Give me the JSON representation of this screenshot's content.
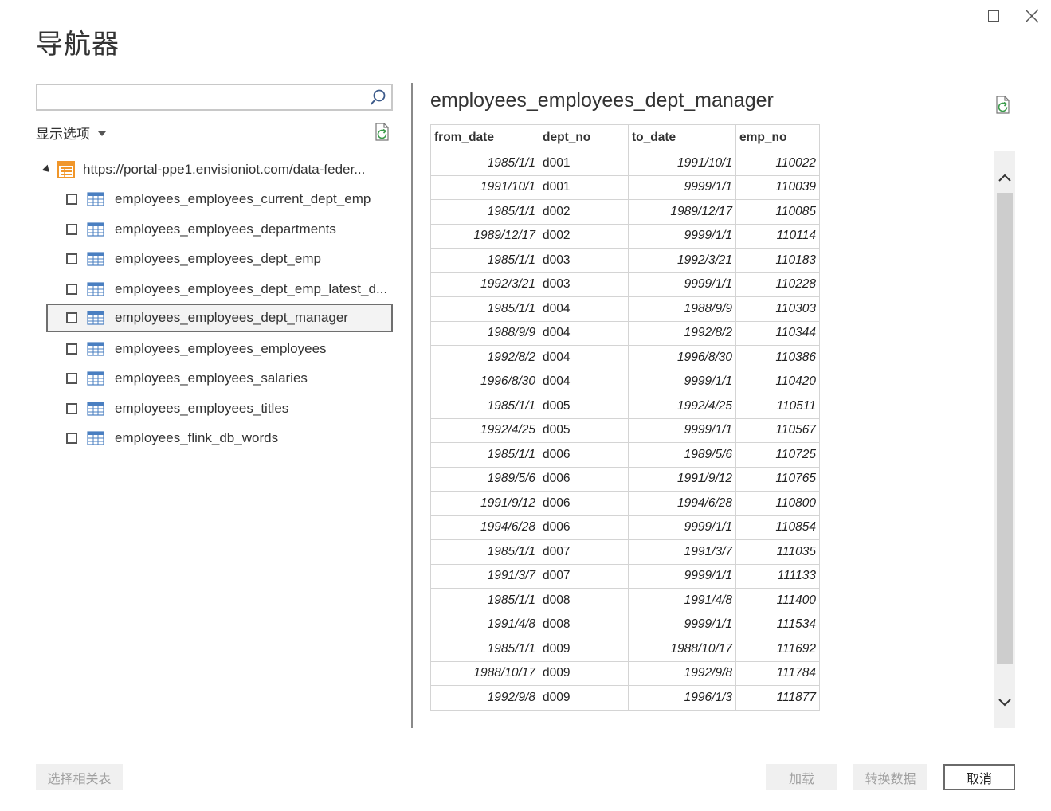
{
  "window": {
    "title": "导航器"
  },
  "search": {
    "value": "",
    "placeholder": ""
  },
  "left": {
    "display_options_label": "显示选项",
    "root_label": "https://portal-ppe1.envisioniot.com/data-feder...",
    "items": [
      {
        "label": "employees_employees_current_dept_emp",
        "checked": false
      },
      {
        "label": "employees_employees_departments",
        "checked": false
      },
      {
        "label": "employees_employees_dept_emp",
        "checked": false
      },
      {
        "label": "employees_employees_dept_emp_latest_d...",
        "checked": false
      },
      {
        "label": "employees_employees_dept_manager",
        "checked": false,
        "selected": true
      },
      {
        "label": "employees_employees_employees",
        "checked": false
      },
      {
        "label": "employees_employees_salaries",
        "checked": false
      },
      {
        "label": "employees_employees_titles",
        "checked": false
      },
      {
        "label": "employees_flink_db_words",
        "checked": false
      }
    ]
  },
  "preview": {
    "title": "employees_employees_dept_manager",
    "columns": [
      "from_date",
      "dept_no",
      "to_date",
      "emp_no"
    ],
    "rows": [
      [
        "1985/1/1",
        "d001",
        "1991/10/1",
        "110022"
      ],
      [
        "1991/10/1",
        "d001",
        "9999/1/1",
        "110039"
      ],
      [
        "1985/1/1",
        "d002",
        "1989/12/17",
        "110085"
      ],
      [
        "1989/12/17",
        "d002",
        "9999/1/1",
        "110114"
      ],
      [
        "1985/1/1",
        "d003",
        "1992/3/21",
        "110183"
      ],
      [
        "1992/3/21",
        "d003",
        "9999/1/1",
        "110228"
      ],
      [
        "1985/1/1",
        "d004",
        "1988/9/9",
        "110303"
      ],
      [
        "1988/9/9",
        "d004",
        "1992/8/2",
        "110344"
      ],
      [
        "1992/8/2",
        "d004",
        "1996/8/30",
        "110386"
      ],
      [
        "1996/8/30",
        "d004",
        "9999/1/1",
        "110420"
      ],
      [
        "1985/1/1",
        "d005",
        "1992/4/25",
        "110511"
      ],
      [
        "1992/4/25",
        "d005",
        "9999/1/1",
        "110567"
      ],
      [
        "1985/1/1",
        "d006",
        "1989/5/6",
        "110725"
      ],
      [
        "1989/5/6",
        "d006",
        "1991/9/12",
        "110765"
      ],
      [
        "1991/9/12",
        "d006",
        "1994/6/28",
        "110800"
      ],
      [
        "1994/6/28",
        "d006",
        "9999/1/1",
        "110854"
      ],
      [
        "1985/1/1",
        "d007",
        "1991/3/7",
        "111035"
      ],
      [
        "1991/3/7",
        "d007",
        "9999/1/1",
        "111133"
      ],
      [
        "1985/1/1",
        "d008",
        "1991/4/8",
        "111400"
      ],
      [
        "1991/4/8",
        "d008",
        "9999/1/1",
        "111534"
      ],
      [
        "1985/1/1",
        "d009",
        "1988/10/17",
        "111692"
      ],
      [
        "1988/10/17",
        "d009",
        "1992/9/8",
        "111784"
      ],
      [
        "1992/9/8",
        "d009",
        "1996/1/3",
        "111877"
      ]
    ]
  },
  "footer": {
    "select_related_label": "选择相关表",
    "load_label": "加载",
    "transform_label": "转换数据",
    "cancel_label": "取消"
  },
  "colors": {
    "accent_orange": "#f0962a",
    "table_icon_blue": "#4a7fc1",
    "refresh_green": "#3a9a4a"
  }
}
